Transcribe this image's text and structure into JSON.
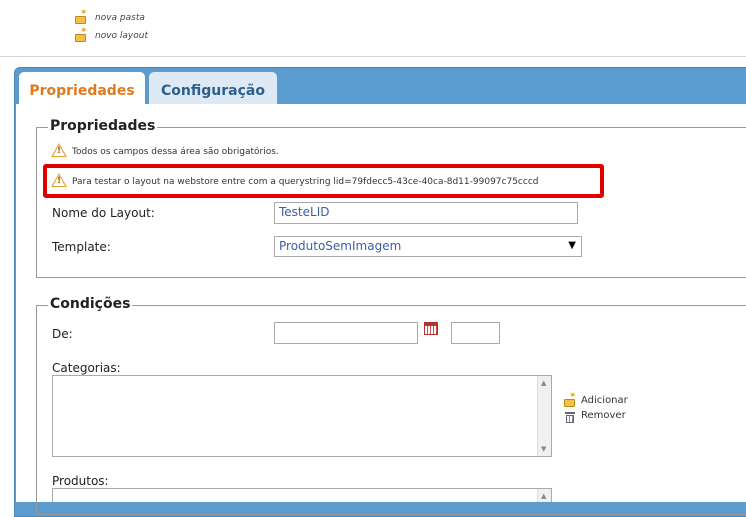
{
  "top_links": [
    {
      "label": "nova pasta",
      "icon": "new-folder-icon"
    },
    {
      "label": "novo layout",
      "icon": "new-layout-icon"
    }
  ],
  "tabs": [
    {
      "label": "Propriedades",
      "active": true
    },
    {
      "label": "Configuração",
      "active": false
    }
  ],
  "propriedades": {
    "legend": "Propriedades",
    "required_notice": "Todos os campos dessa área são obrigatórios.",
    "test_notice": "Para testar o layout na webstore entre com a querystring lid=79fdecc5-43ce-40ca-8d11-99097c75cccd",
    "layout_name_label": "Nome do Layout:",
    "layout_name_value": "TesteLID",
    "template_label": "Template:",
    "template_value": "ProdutoSemImagem"
  },
  "condicoes": {
    "legend": "Condições",
    "de_label": "De:",
    "de_date_value": "",
    "de_time_value": "",
    "categorias_label": "Categorias:",
    "adicionar_label": "Adicionar",
    "remover_label": "Remover",
    "produtos_label": "Produtos:"
  },
  "colors": {
    "accent_tab": "#e07a1f",
    "panel_blue": "#5a9bd0",
    "highlight_red": "#e00000",
    "warning": "#e7a23a"
  }
}
